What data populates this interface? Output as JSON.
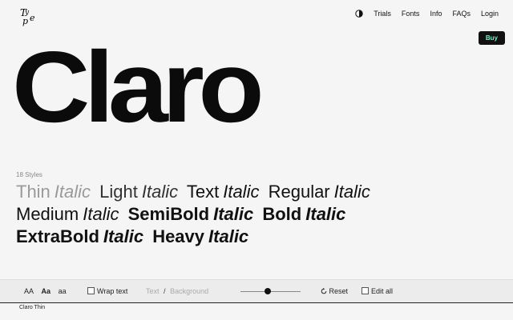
{
  "nav": {
    "items": [
      "Trials",
      "Fonts",
      "Info",
      "FAQs",
      "Login"
    ],
    "buy": "Buy"
  },
  "hero": {
    "title": "Claro"
  },
  "styles": {
    "count": "18 Styles",
    "items": [
      {
        "name": "Thin",
        "italic": "Italic"
      },
      {
        "name": "Light",
        "italic": "Italic"
      },
      {
        "name": "Text",
        "italic": "Italic"
      },
      {
        "name": "Regular",
        "italic": "Italic"
      },
      {
        "name": "Medium",
        "italic": "Italic"
      },
      {
        "name": "SemiBold",
        "italic": "Italic"
      },
      {
        "name": "Bold",
        "italic": "Italic"
      },
      {
        "name": "ExtraBold",
        "italic": "Italic"
      },
      {
        "name": "Heavy",
        "italic": "Italic"
      }
    ]
  },
  "toolbar": {
    "case_options": [
      "AA",
      "Aa",
      "aa"
    ],
    "wrap_text": "Wrap text",
    "text_label": "Text",
    "separator": "/",
    "background_label": "Background",
    "reset": "Reset",
    "edit_all": "Edit all",
    "slider_value": 0.45
  },
  "footer": {
    "current_style": "Claro Thin"
  },
  "colors": {
    "accent": "#7ef0c8"
  }
}
